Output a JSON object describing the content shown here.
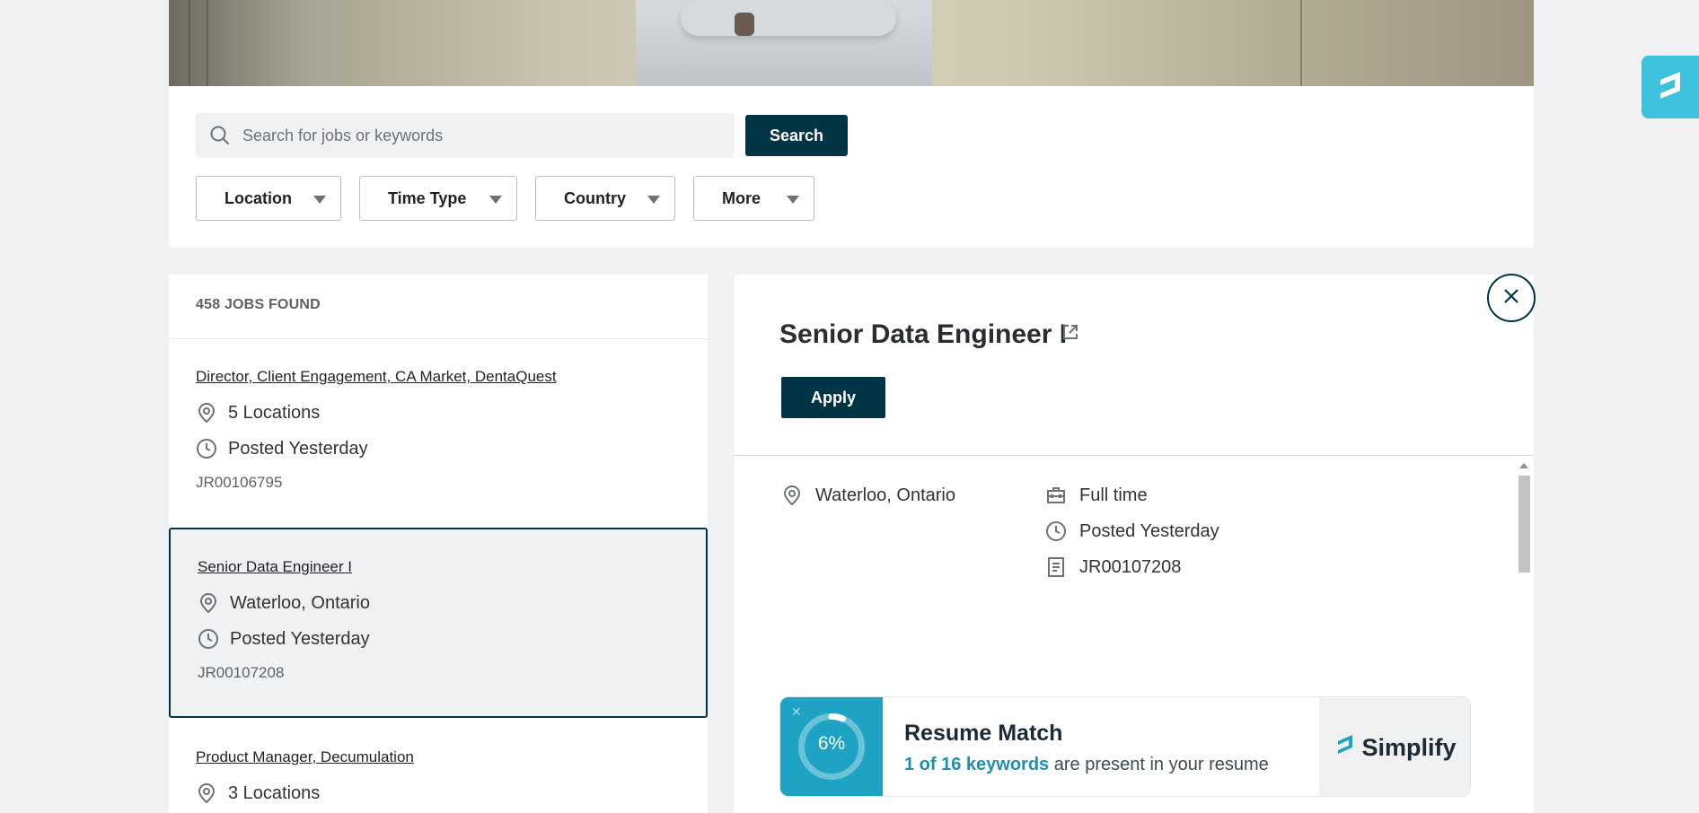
{
  "search": {
    "placeholder": "Search for jobs or keywords",
    "button_label": "Search"
  },
  "filters": [
    {
      "label": "Location"
    },
    {
      "label": "Time Type"
    },
    {
      "label": "Country"
    },
    {
      "label": "More"
    }
  ],
  "results": {
    "count_label": "458 JOBS FOUND",
    "jobs": [
      {
        "title": "Director, Client Engagement, CA Market, DentaQuest",
        "location": "5 Locations",
        "posted": "Posted Yesterday",
        "id": "JR00106795"
      },
      {
        "title": "Senior Data Engineer I",
        "location": "Waterloo, Ontario",
        "posted": "Posted Yesterday",
        "id": "JR00107208"
      },
      {
        "title": "Product Manager, Decumulation",
        "location": "3 Locations"
      }
    ]
  },
  "detail": {
    "title": "Senior Data Engineer I",
    "apply_label": "Apply",
    "location": "Waterloo, Ontario",
    "time_type": "Full time",
    "posted": "Posted Yesterday",
    "id": "JR00107208"
  },
  "resume_match": {
    "percent": "6%",
    "percent_value": 6,
    "title": "Resume Match",
    "keywords_text": "1 of 16 keywords",
    "rest_text": "are present in your resume",
    "brand": "Simplify",
    "accent_color": "#1ea3c4"
  },
  "colors": {
    "primary": "#013545",
    "page_bg": "#eff1f2",
    "simplify_tab": "#3cc2dd"
  }
}
